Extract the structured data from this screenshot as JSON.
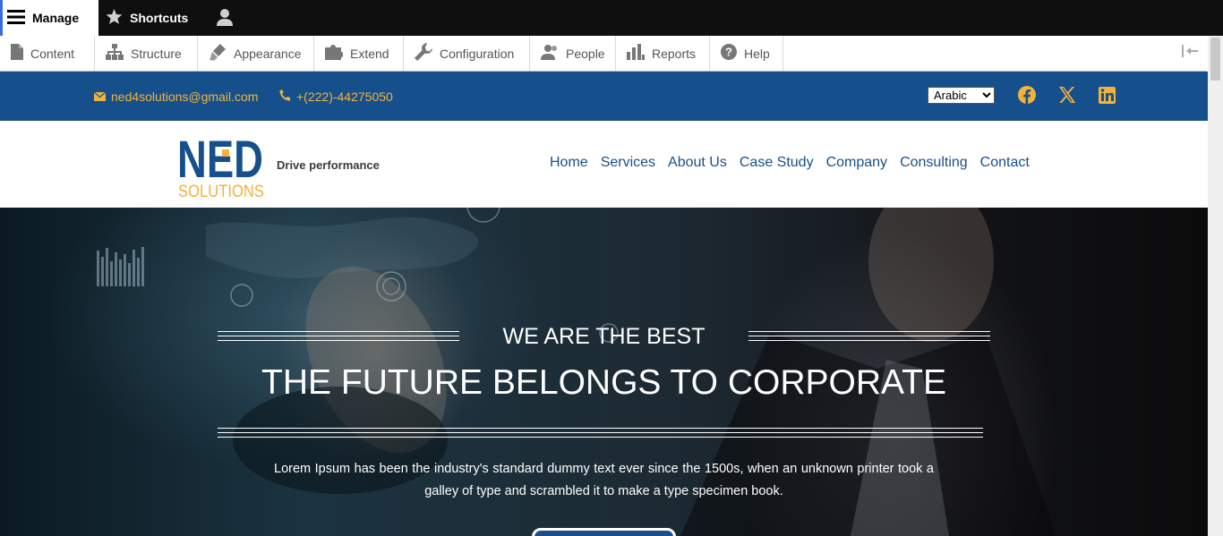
{
  "admin": {
    "manage_label": "Manage",
    "shortcuts_label": "Shortcuts",
    "tray": [
      {
        "label": "Content",
        "icon": "file-icon"
      },
      {
        "label": "Structure",
        "icon": "sitemap-icon"
      },
      {
        "label": "Appearance",
        "icon": "brush-icon"
      },
      {
        "label": "Extend",
        "icon": "puzzle-icon"
      },
      {
        "label": "Configuration",
        "icon": "wrench-icon"
      },
      {
        "label": "People",
        "icon": "people-icon"
      },
      {
        "label": "Reports",
        "icon": "bar-chart-icon"
      },
      {
        "label": "Help",
        "icon": "help-icon"
      }
    ]
  },
  "topbar": {
    "email": "ned4solutions@gmail.com",
    "phone": "+(222)-44275050",
    "language": "Arabic",
    "social_icons": [
      "facebook-icon",
      "x-icon",
      "linkedin-icon"
    ]
  },
  "header": {
    "logo_main": "NED",
    "logo_sub": "SOLUTIONS",
    "slogan": "Drive performance",
    "nav": [
      "Home",
      "Services",
      "About Us",
      "Case Study",
      "Company",
      "Consulting",
      "Contact"
    ]
  },
  "hero": {
    "kicker": "WE ARE THE BEST",
    "title": "THE FUTURE BELONGS TO CORPORATE",
    "text": "Lorem Ipsum has been the industry's standard dummy text ever since the 1500s, when an unknown printer took a galley of type and scrambled it to make a type specimen book."
  },
  "colors": {
    "brand_blue": "#16508c",
    "accent_orange": "#f2b23a",
    "nav_text": "#1a4f8b"
  }
}
